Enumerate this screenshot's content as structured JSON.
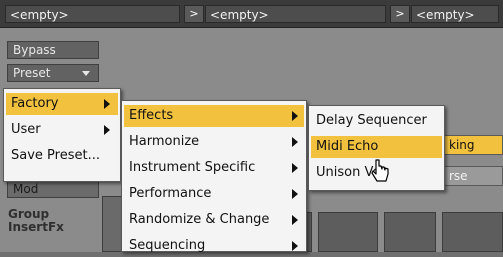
{
  "slots": [
    "<empty>",
    "<empty>",
    "<empty>"
  ],
  "slot_arrow": ">",
  "side": {
    "bypass": "Bypass",
    "preset": "Preset",
    "mod": "Mod",
    "group_insertfx": "Group\nInsertFx"
  },
  "right_labels": {
    "king": "king",
    "rse": "rse"
  },
  "menu_main": [
    "Factory",
    "User",
    "Save Preset..."
  ],
  "menu_factory": [
    "Effects",
    "Harmonize",
    "Instrument Specific",
    "Performance",
    "Randomize & Change",
    "Sequencing"
  ],
  "menu_effects": [
    "Delay Sequencer",
    "Midi Echo",
    "Unison Vox"
  ],
  "colors": {
    "highlight": "#f2c23e",
    "menu_bg": "#f4f4f4",
    "topbar": "#3b3b3b"
  }
}
